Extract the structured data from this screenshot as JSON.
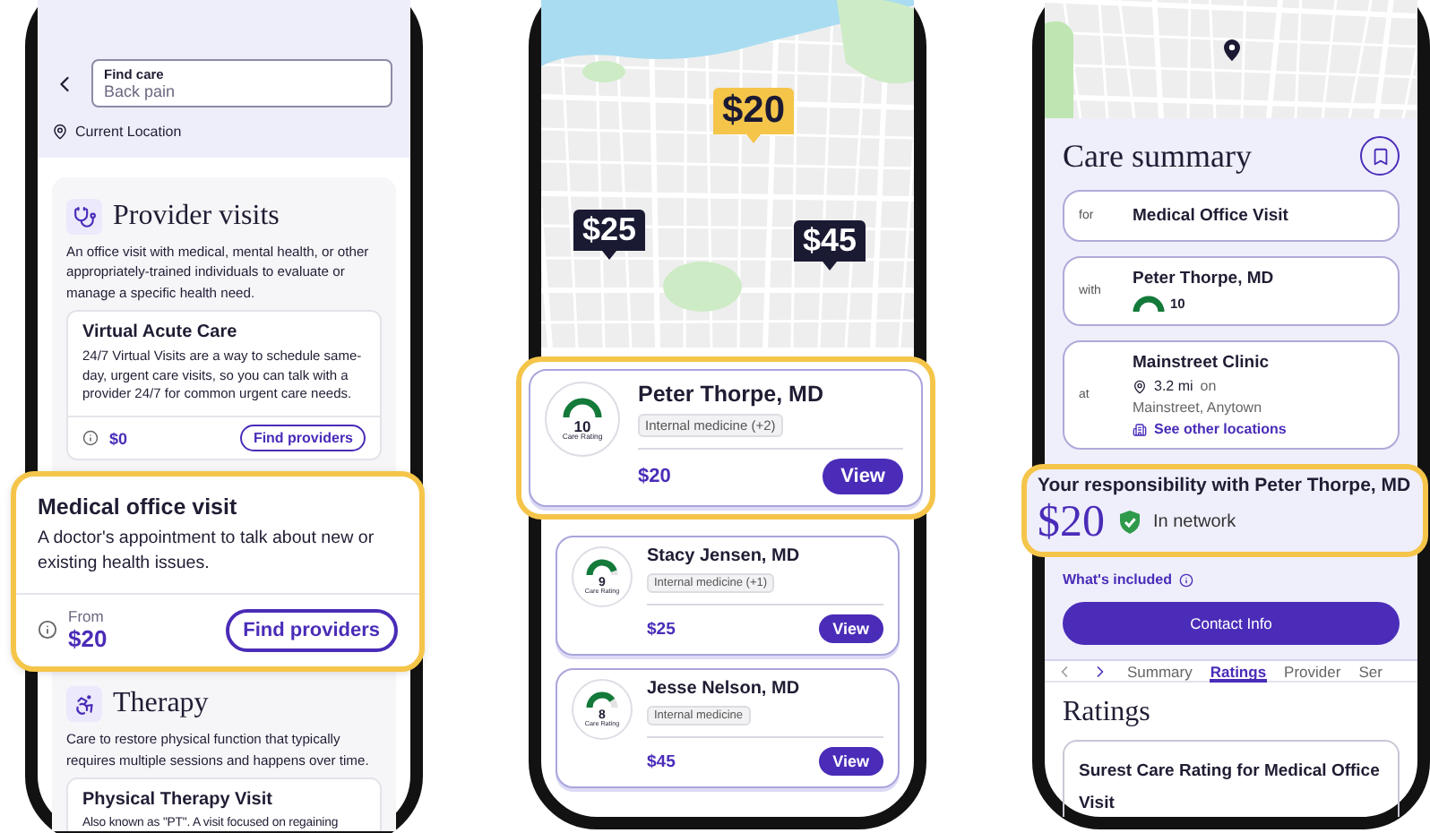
{
  "search_screen": {
    "search": {
      "label": "Find care",
      "value": "Back pain"
    },
    "location": "Current Location",
    "sections": [
      {
        "title": "Provider visits",
        "description": "An office visit with medical, mental health, or other appropriately-trained individuals to evaluate or manage a specific health need.",
        "cards": [
          {
            "title": "Virtual Acute Care",
            "description": "24/7 Virtual Visits are a way to schedule same-day, urgent care visits, so you can talk with a provider 24/7 for common urgent care needs.",
            "price": "$0",
            "button": "Find providers",
            "highlighted": false
          },
          {
            "title": "Medical office visit",
            "description": "A doctor's appointment to talk about new or existing health issues.",
            "price_prefix": "From",
            "price": "$20",
            "button": "Find providers",
            "highlighted": true
          }
        ]
      },
      {
        "title": "Therapy",
        "description": "Care to restore physical function that typically requires multiple sessions and happens over time.",
        "cards": [
          {
            "title": "Physical Therapy Visit",
            "description": "Also known as \"PT\". A visit focused on regaining",
            "highlighted": false
          }
        ]
      }
    ]
  },
  "map_screen": {
    "pins": [
      {
        "label": "$20",
        "selected": true
      },
      {
        "label": "$25",
        "selected": false
      },
      {
        "label": "$45",
        "selected": false
      }
    ],
    "providers": [
      {
        "name": "Peter Thorpe, MD",
        "rating": "10",
        "rating_label": "Care Rating",
        "specialty": "Internal medicine (+2)",
        "price": "$20",
        "button": "View",
        "highlighted": true
      },
      {
        "name": "Stacy Jensen, MD",
        "rating": "9",
        "rating_label": "Care Rating",
        "specialty": "Internal medicine (+1)",
        "price": "$25",
        "button": "View",
        "highlighted": false
      },
      {
        "name": "Jesse Nelson, MD",
        "rating": "8",
        "rating_label": "Care Rating",
        "specialty": "Internal medicine",
        "price": "$45",
        "button": "View",
        "highlighted": false
      }
    ]
  },
  "summary_screen": {
    "title": "Care summary",
    "rows": [
      {
        "kind": "text",
        "prefix": "for",
        "value": "Medical Office Visit"
      },
      {
        "kind": "provider",
        "prefix": "with",
        "name": "Peter Thorpe, MD",
        "rating": "10"
      },
      {
        "kind": "location",
        "prefix": "at",
        "name": "Mainstreet Clinic",
        "distance": "3.2 mi",
        "distance_suffix": "on",
        "address": "Mainstreet, Anytown",
        "link": "See other locations"
      }
    ],
    "responsibility": {
      "title": "Your responsibility with Peter Thorpe, MD",
      "amount": "$20",
      "network": "In network"
    },
    "included_link": "What's included",
    "contact_button": "Contact Info",
    "tabs": [
      {
        "label": "Summary",
        "selected": false
      },
      {
        "label": "Ratings",
        "selected": true
      },
      {
        "label": "Provider",
        "selected": false
      },
      {
        "label": "Ser",
        "selected": false
      }
    ],
    "section_title": "Ratings",
    "rating_card_title": "Surest Care Rating for Medical Office Visit"
  }
}
